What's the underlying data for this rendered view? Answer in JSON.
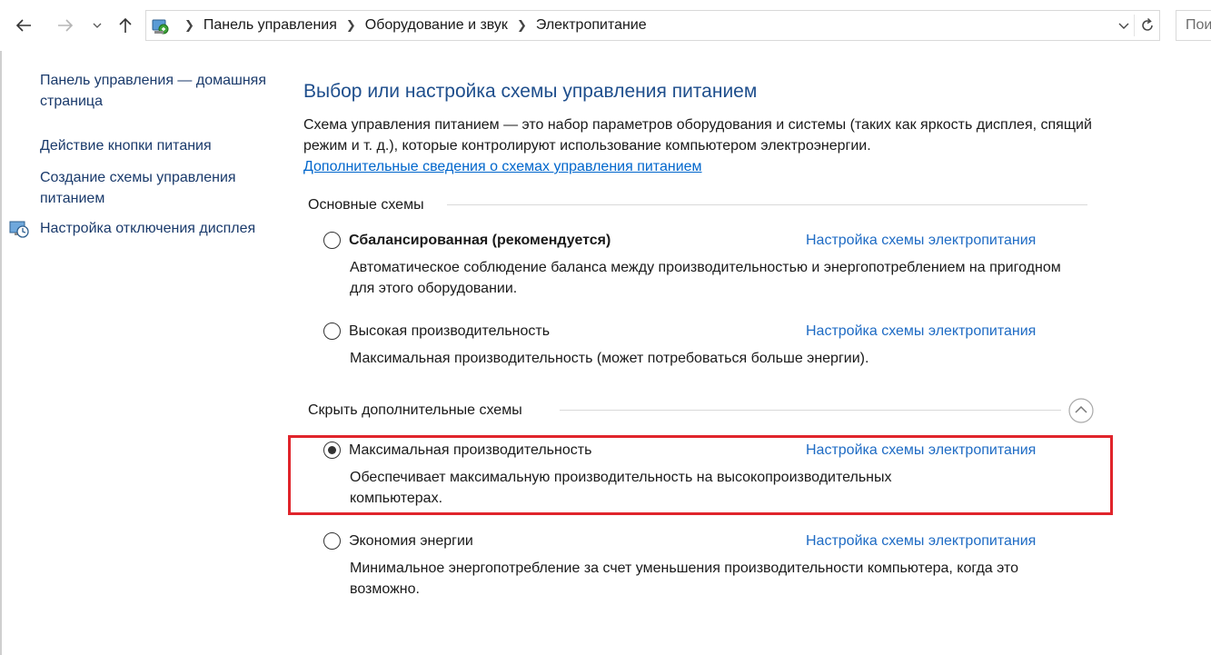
{
  "address_bar": {
    "breadcrumbs": [
      "Панель управления",
      "Оборудование и звук",
      "Электропитание"
    ],
    "search_placeholder": "Пои"
  },
  "sidebar": {
    "links": [
      {
        "label": "Панель управления — домашняя страница"
      },
      {
        "label": "Действие кнопки питания"
      },
      {
        "label": "Создание схемы управления питанием"
      },
      {
        "label": "Настройка отключения дисплея"
      }
    ]
  },
  "main": {
    "title": "Выбор или настройка схемы управления питанием",
    "intro": "Схема управления питанием — это набор параметров оборудования и системы (таких как яркость дисплея, спящий режим и т. д.), которые контролируют использование компьютером электроэнергии.",
    "more_info_link": "Дополнительные сведения о схемах управления питанием",
    "basic_group_label": "Основные схемы",
    "extra_group_label": "Скрыть дополнительные схемы",
    "plan_settings_link": "Настройка схемы электропитания",
    "plans": [
      {
        "name": "Сбалансированная (рекомендуется)",
        "description": "Автоматическое соблюдение баланса между производительностью и энергопотреблением на пригодном для этого оборудовании.",
        "selected": false,
        "bold": true
      },
      {
        "name": "Высокая производительность",
        "description": "Максимальная производительность (может потребоваться больше энергии).",
        "selected": false,
        "bold": false
      },
      {
        "name": "Максимальная производительность",
        "description": "Обеспечивает максимальную производительность на высокопроизводительных компьютерах.",
        "selected": true,
        "bold": false
      },
      {
        "name": "Экономия энергии",
        "description": "Минимальное энергопотребление за счет уменьшения производительности компьютера, когда это возможно.",
        "selected": false,
        "bold": false
      }
    ]
  },
  "colors": {
    "title": "#1e4e8c",
    "link": "#1e6bc4",
    "highlight": "#e0242b"
  }
}
